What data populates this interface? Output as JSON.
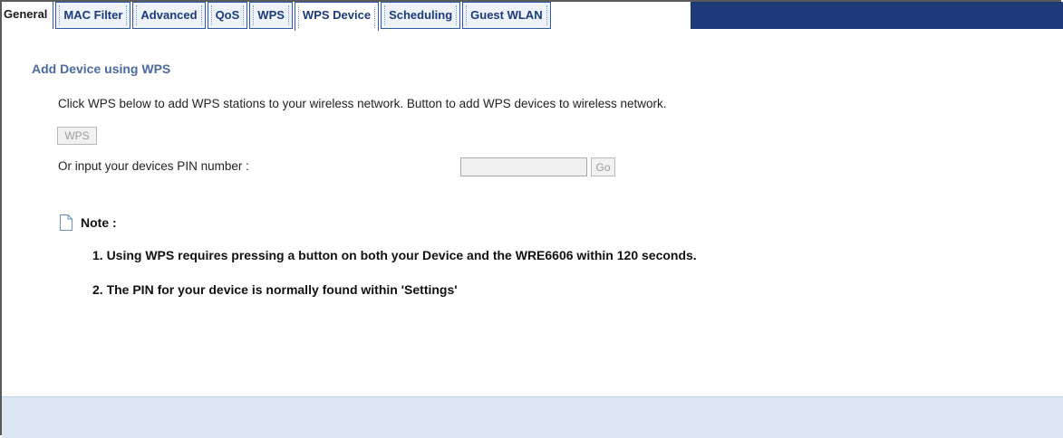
{
  "tabs": [
    {
      "label": "General",
      "active": false
    },
    {
      "label": "MAC Filter",
      "active": false
    },
    {
      "label": "Advanced",
      "active": false
    },
    {
      "label": "QoS",
      "active": false
    },
    {
      "label": "WPS",
      "active": false
    },
    {
      "label": "WPS Device",
      "active": true
    },
    {
      "label": "Scheduling",
      "active": false
    },
    {
      "label": "Guest WLAN",
      "active": false
    }
  ],
  "section": {
    "title": "Add Device using WPS",
    "description": "Click WPS below to add WPS stations to your wireless network. Button to add WPS devices to wireless network."
  },
  "wps_button": {
    "label": "WPS"
  },
  "pin": {
    "label": "Or input your devices PIN number :",
    "value": "",
    "go_label": "Go"
  },
  "note": {
    "label": "Note :",
    "icon": "note-page-icon",
    "items": [
      "1. Using WPS requires pressing a button on both your Device and the WRE6606 within 120 seconds.",
      "2. The PIN for your device is normally found within 'Settings'"
    ]
  },
  "colors": {
    "tab_bar_fill": "#1e3a78",
    "tab_text": "#1a3a7a",
    "section_title": "#4a6aa0",
    "footer": "#dde6f3"
  }
}
